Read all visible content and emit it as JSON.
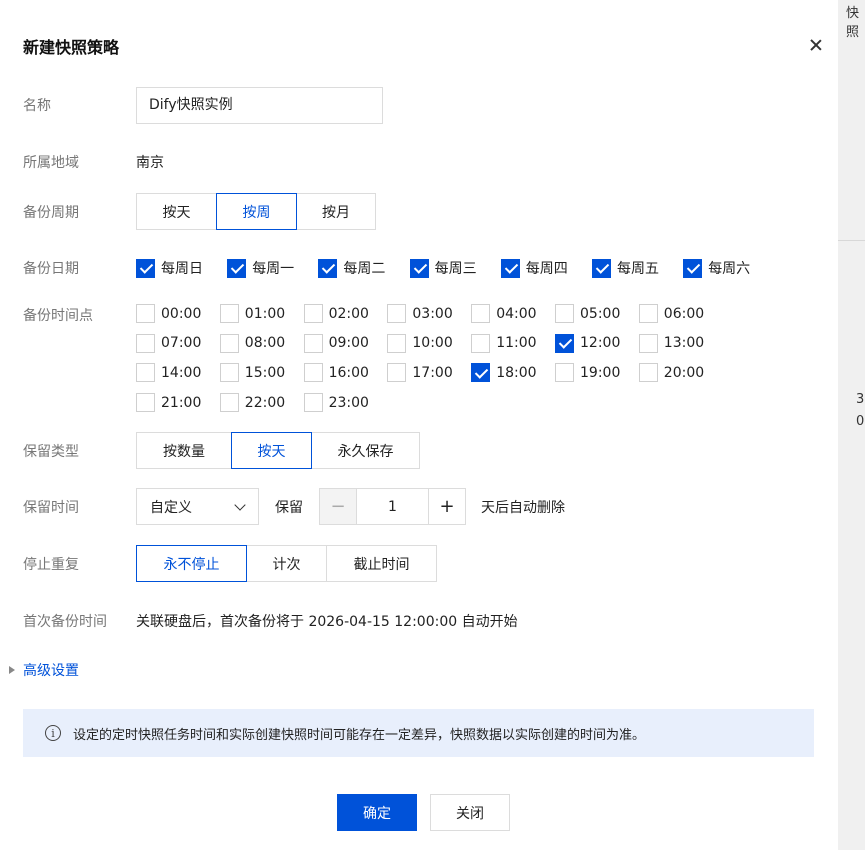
{
  "background_fragments": [
    "快照",
    "3",
    "0"
  ],
  "dialog": {
    "title": "新建快照策略",
    "close_icon": "close-icon"
  },
  "form": {
    "name": {
      "label": "名称",
      "value": "Dify快照实例"
    },
    "region": {
      "label": "所属地域",
      "value": "南京"
    },
    "cycle": {
      "label": "备份周期",
      "options": [
        "按天",
        "按周",
        "按月"
      ],
      "selected": "按周"
    },
    "days": {
      "label": "备份日期",
      "items": [
        {
          "label": "每周日",
          "checked": true
        },
        {
          "label": "每周一",
          "checked": true
        },
        {
          "label": "每周二",
          "checked": true
        },
        {
          "label": "每周三",
          "checked": true
        },
        {
          "label": "每周四",
          "checked": true
        },
        {
          "label": "每周五",
          "checked": true
        },
        {
          "label": "每周六",
          "checked": true
        }
      ]
    },
    "times": {
      "label": "备份时间点",
      "items": [
        {
          "label": "00:00",
          "checked": false
        },
        {
          "label": "01:00",
          "checked": false
        },
        {
          "label": "02:00",
          "checked": false
        },
        {
          "label": "03:00",
          "checked": false
        },
        {
          "label": "04:00",
          "checked": false
        },
        {
          "label": "05:00",
          "checked": false
        },
        {
          "label": "06:00",
          "checked": false
        },
        {
          "label": "07:00",
          "checked": false
        },
        {
          "label": "08:00",
          "checked": false
        },
        {
          "label": "09:00",
          "checked": false
        },
        {
          "label": "10:00",
          "checked": false
        },
        {
          "label": "11:00",
          "checked": false
        },
        {
          "label": "12:00",
          "checked": true
        },
        {
          "label": "13:00",
          "checked": false
        },
        {
          "label": "14:00",
          "checked": false
        },
        {
          "label": "15:00",
          "checked": false
        },
        {
          "label": "16:00",
          "checked": false
        },
        {
          "label": "17:00",
          "checked": false
        },
        {
          "label": "18:00",
          "checked": true
        },
        {
          "label": "19:00",
          "checked": false
        },
        {
          "label": "20:00",
          "checked": false
        },
        {
          "label": "21:00",
          "checked": false
        },
        {
          "label": "22:00",
          "checked": false
        },
        {
          "label": "23:00",
          "checked": false
        }
      ]
    },
    "retention_type": {
      "label": "保留类型",
      "options": [
        "按数量",
        "按天",
        "永久保存"
      ],
      "selected": "按天"
    },
    "retention_time": {
      "label": "保留时间",
      "select_value": "自定义",
      "keep_label": "保留",
      "minus": "−",
      "value": "1",
      "plus": "+",
      "suffix": "天后自动删除"
    },
    "stop_repeat": {
      "label": "停止重复",
      "options": [
        "永不停止",
        "计次",
        "截止时间"
      ],
      "selected": "永不停止"
    },
    "first_backup": {
      "label": "首次备份时间",
      "value": "关联硬盘后，首次备份将于 2026-04-15 12:00:00 自动开始"
    }
  },
  "advanced": {
    "label": "高级设置"
  },
  "notice": {
    "icon": "info-icon",
    "text": "设定的定时快照任务时间和实际创建快照时间可能存在一定差异，快照数据以实际创建的时间为准。"
  },
  "footer": {
    "confirm": "确定",
    "close": "关闭"
  },
  "colors": {
    "primary": "#0052d9",
    "notice_bg": "#e8effc"
  }
}
